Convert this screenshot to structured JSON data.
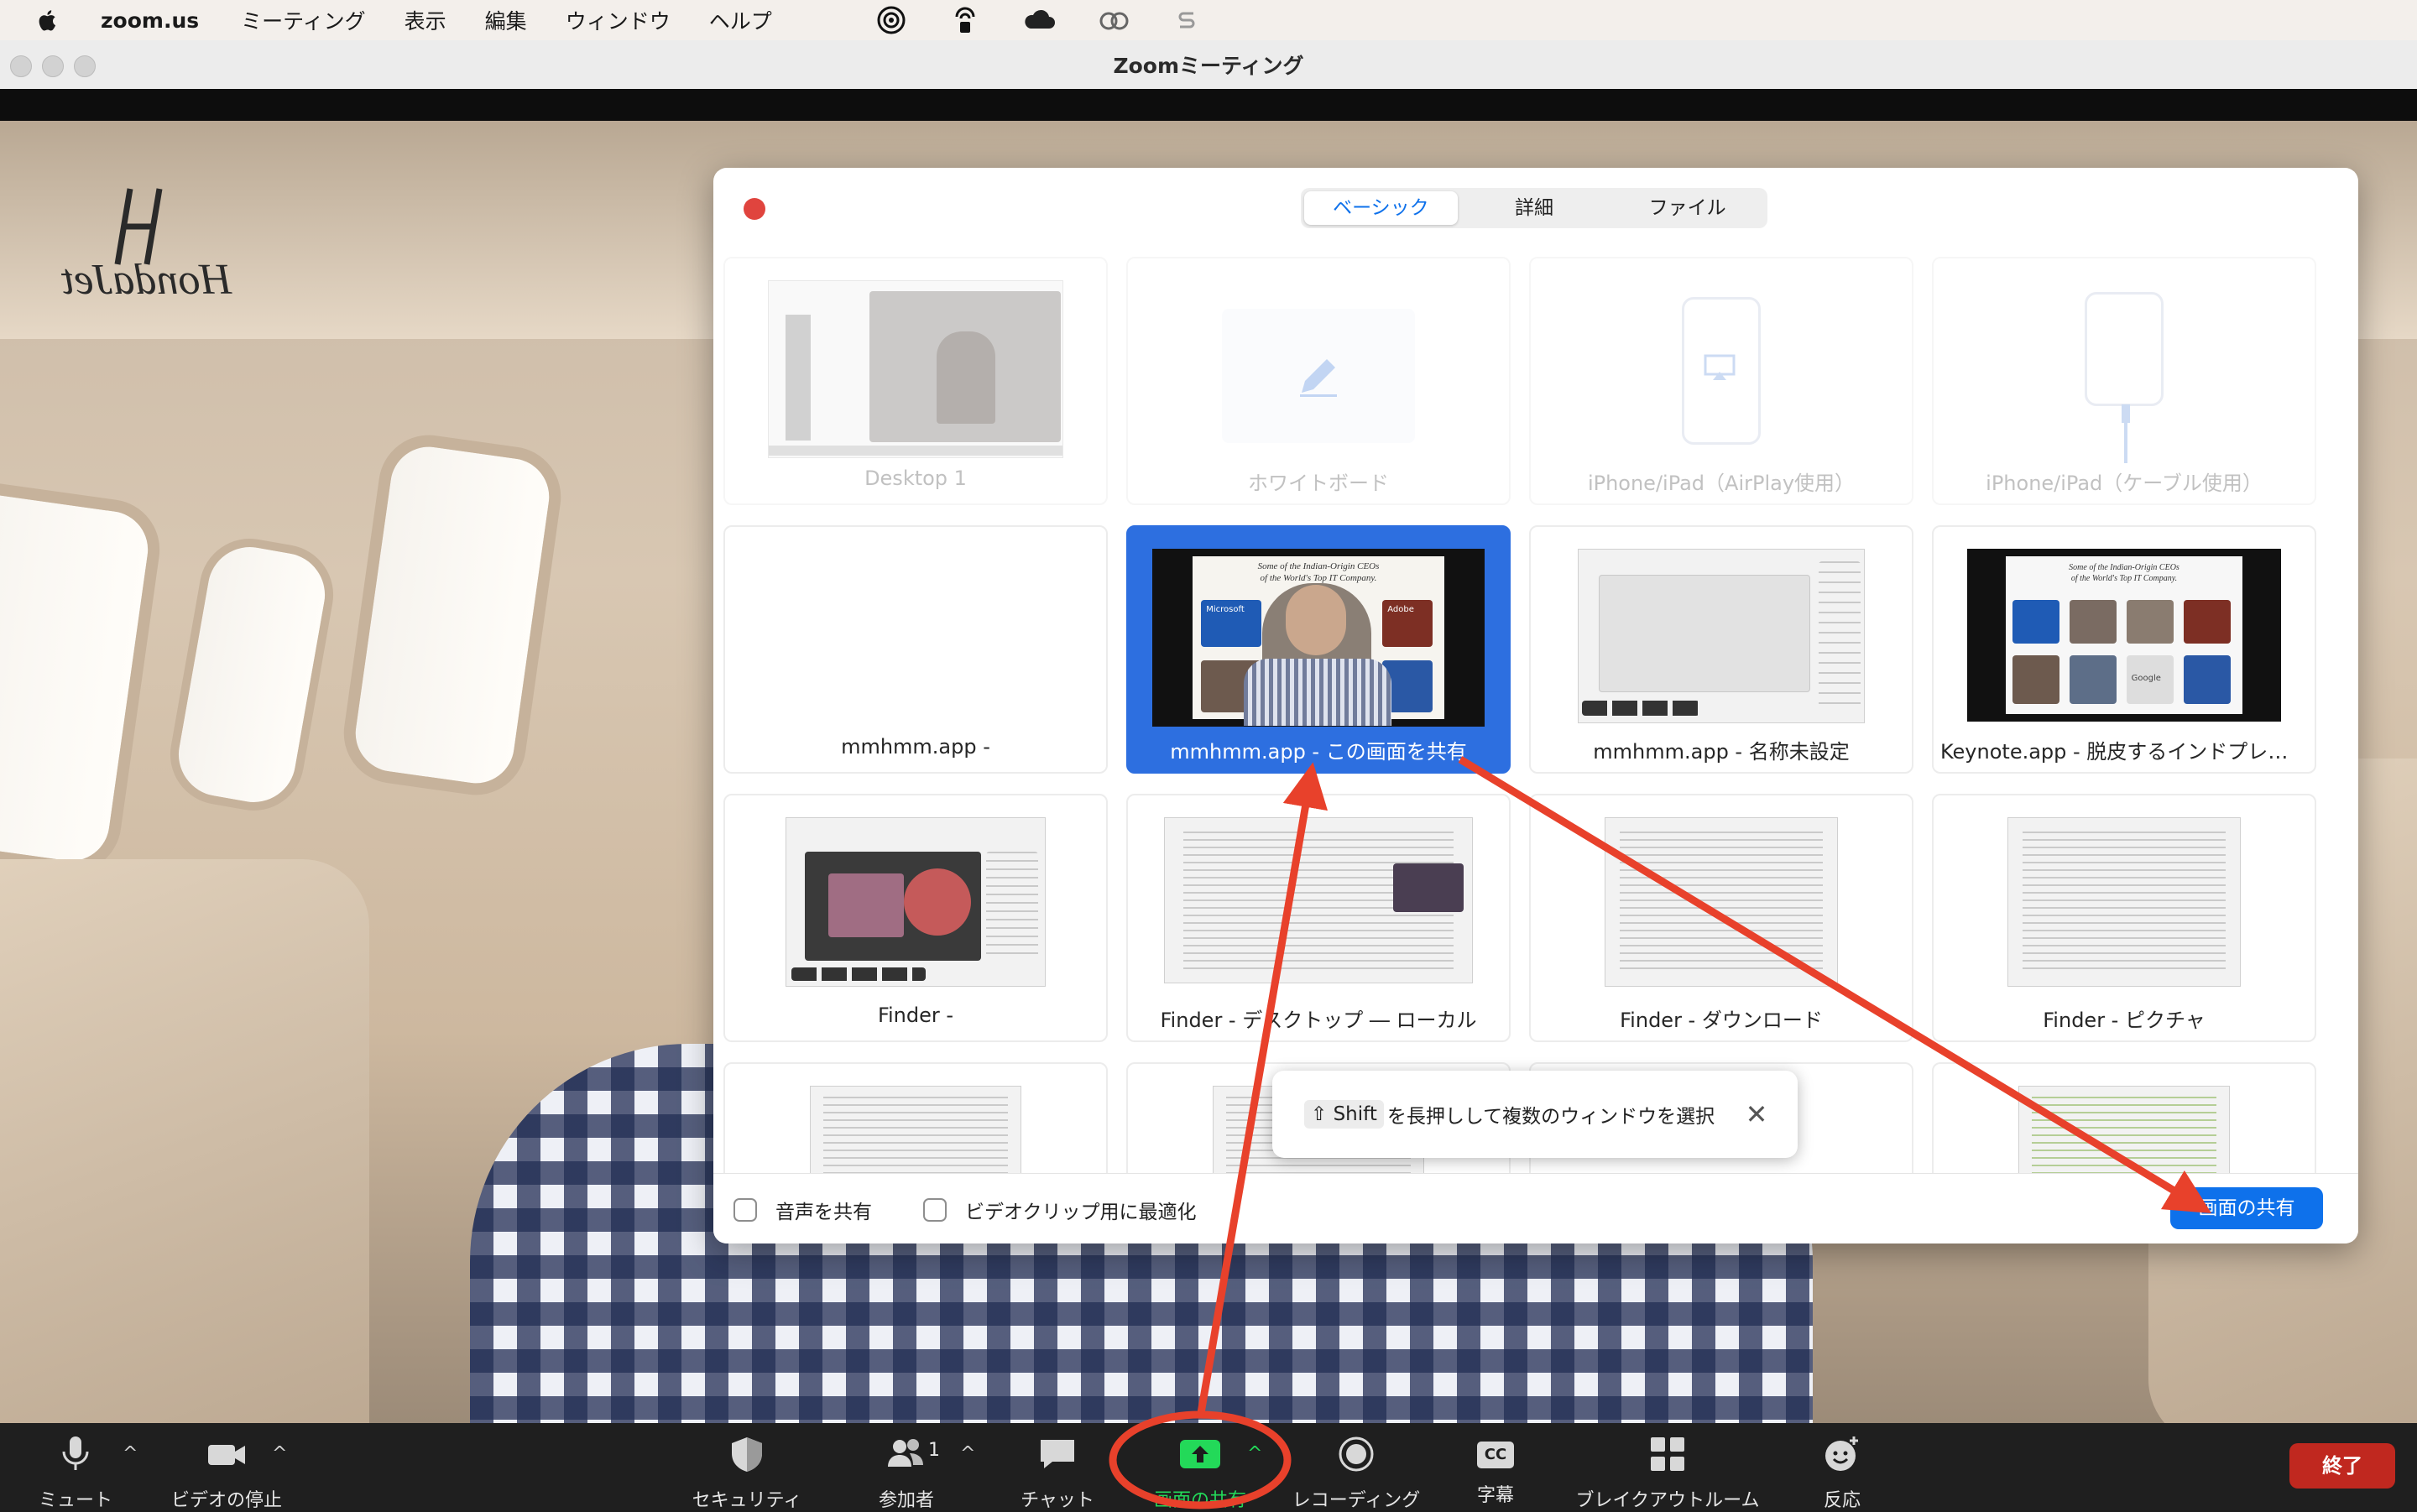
{
  "menubar": {
    "app_name": "zoom.us",
    "items": [
      "ミーティング",
      "表示",
      "編集",
      "ウィンドウ",
      "ヘルプ"
    ]
  },
  "window": {
    "title": "Zoomミーティング"
  },
  "video": {
    "logo_text": "HondaJet"
  },
  "dialog": {
    "tabs": [
      "ベーシック",
      "詳細",
      "ファイル"
    ],
    "active_tab": "ベーシック",
    "sources": [
      {
        "label": "Desktop 1"
      },
      {
        "label": "ホワイトボード"
      },
      {
        "label": "iPhone/iPad（AirPlay使用）"
      },
      {
        "label": "iPhone/iPad（ケーブル使用）"
      },
      {
        "label": "mmhmm.app -"
      },
      {
        "label": "mmhmm.app - この画面を共有",
        "selected": true
      },
      {
        "label": "mmhmm.app - 名称未設定"
      },
      {
        "label": "Keynote.app - 脱皮するインドプレゼ…"
      },
      {
        "label": "Finder -"
      },
      {
        "label": "Finder - デスクトップ ― ローカル"
      },
      {
        "label": "Finder - ダウンロード"
      },
      {
        "label": "Finder - ピクチャ"
      }
    ],
    "thumb_text": {
      "slide_title_1": "Some of the Indian-Origin CEOs",
      "slide_title_2": "of the World's Top IT Company.",
      "microsoft": "Microsoft",
      "adobe": "Adobe",
      "google": "Google"
    },
    "share_audio_label": "音声を共有",
    "optimize_video_label": "ビデオクリップ用に最適化",
    "share_button": "画面の共有",
    "tip": {
      "key": "⇧ Shift",
      "text": "を長押しして複数のウィンドウを選択",
      "close": "✕"
    }
  },
  "toolbar": {
    "mute": "ミュート",
    "stop_video": "ビデオの停止",
    "security": "セキュリティ",
    "participants": "参加者",
    "participants_count": "1",
    "chat": "チャット",
    "share_screen": "画面の共有",
    "record": "レコーディング",
    "captions": "字幕",
    "captions_icon": "CC",
    "breakout": "ブレイクアウトルーム",
    "reactions": "反応",
    "end": "終了"
  },
  "colors": {
    "accent": "#0e71eb",
    "selected_tile": "#2d6fe0",
    "share_icon_green": "#23d959",
    "end_red": "#c0281f",
    "annotation_red": "#e8412b"
  }
}
